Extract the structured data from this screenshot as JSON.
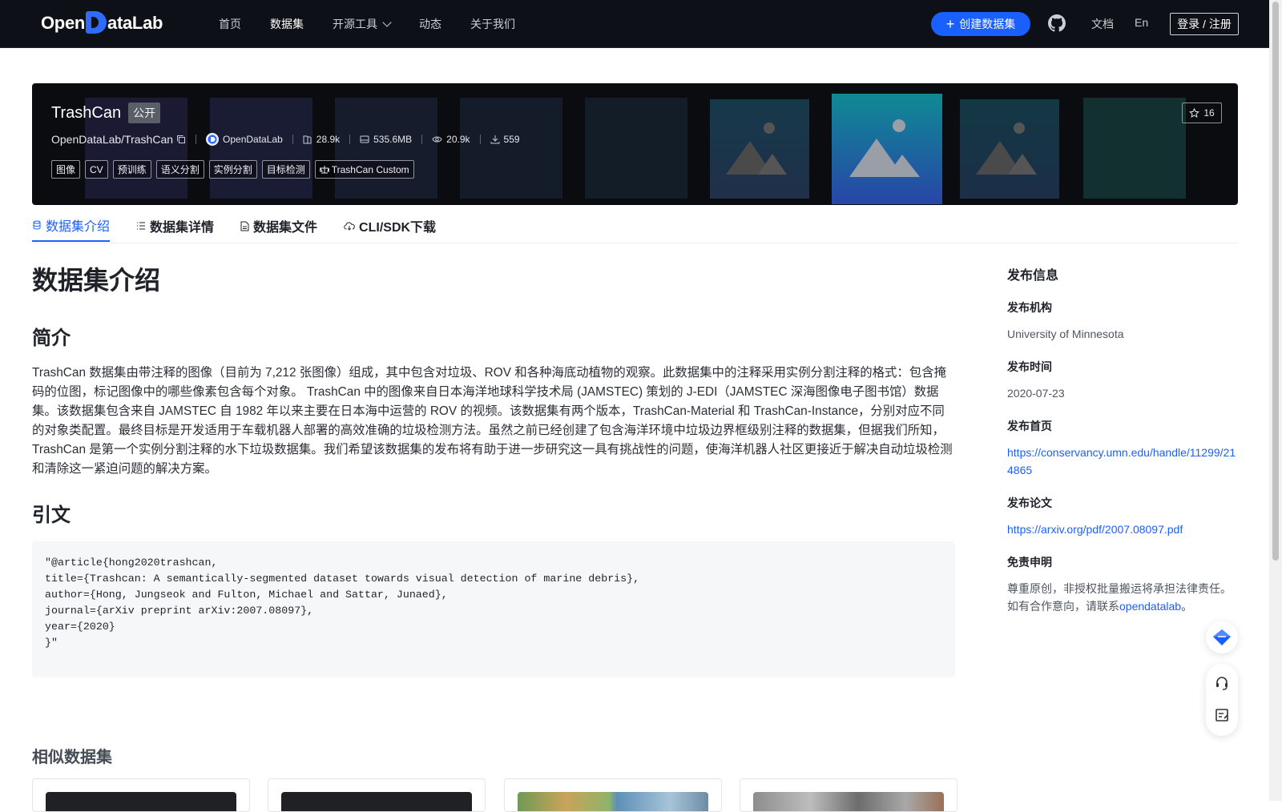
{
  "nav": {
    "logo_text_left": "Open",
    "logo_text_right": "ataLab",
    "items": [
      {
        "label": "首页",
        "active": false
      },
      {
        "label": "数据集",
        "active": true
      },
      {
        "label": "开源工具",
        "active": false,
        "has_dropdown": true
      },
      {
        "label": "动态",
        "active": false
      },
      {
        "label": "关于我们",
        "active": false
      }
    ],
    "create_label": "创建数据集",
    "docs_label": "文档",
    "lang_label": "En",
    "login_label": "登录 / 注册"
  },
  "dataset": {
    "title": "TrashCan",
    "visibility": "公开",
    "path": "OpenDataLab/TrashCan",
    "publisher": "OpenDataLab",
    "file_count": "28.9k",
    "size": "535.6MB",
    "views": "20.9k",
    "downloads": "559",
    "stars": "16",
    "tags": [
      "图像",
      "CV",
      "预训练",
      "语义分割",
      "实例分割",
      "目标检测"
    ],
    "license": "TrashCan Custom"
  },
  "tabs": [
    {
      "label": "数据集介绍",
      "active": true
    },
    {
      "label": "数据集详情",
      "active": false
    },
    {
      "label": "数据集文件",
      "active": false
    },
    {
      "label": "CLI/SDK下载",
      "active": false
    }
  ],
  "content": {
    "heading": "数据集介绍",
    "intro_heading": "简介",
    "intro_text": "TrashCan 数据集由带注释的图像（目前为 7,212 张图像）组成，其中包含对垃圾、ROV 和各种海底动植物的观察。此数据集中的注释采用实例分割注释的格式：包含掩码的位图，标记图像中的哪些像素包含每个对象。 TrashCan 中的图像来自日本海洋地球科学技术局 (JAMSTEC) 策划的 J-EDI（JAMSTEC 深海图像电子图书馆）数据集。该数据集包含来自 JAMSTEC 自 1982 年以来主要在日本海中运营的 ROV 的视频。该数据集有两个版本，TrashCan-Material 和 TrashCan-Instance，分别对应不同的对象类配置。最终目标是开发适用于车载机器人部署的高效准确的垃圾检测方法。虽然之前已经创建了包含海洋环境中垃圾边界框级别注释的数据集，但据我们所知，TrashCan 是第一个实例分割注释的水下垃圾数据集。我们希望该数据集的发布将有助于进一步研究这一具有挑战性的问题，使海洋机器人社区更接近于解决自动垃圾检测和清除这一紧迫问题的解决方案。",
    "citation_heading": "引文",
    "citation_code": "\"@article{hong2020trashcan,\ntitle={Trashcan: A semantically-segmented dataset towards visual detection of marine debris},\nauthor={Hong, Jungseok and Fulton, Michael and Sattar, Junaed},\njournal={arXiv preprint arXiv:2007.08097},\nyear={2020}\n}\"",
    "similar_heading": "相似数据集"
  },
  "sidebar": {
    "title": "发布信息",
    "org_label": "发布机构",
    "org_value": "University of Minnesota",
    "date_label": "发布时间",
    "date_value": "2020-07-23",
    "homepage_label": "发布首页",
    "homepage_value": "https://conservancy.umn.edu/handle/11299/214865",
    "paper_label": "发布论文",
    "paper_value": "https://arxiv.org/pdf/2007.08097.pdf",
    "disclaimer_label": "免责申明",
    "disclaimer_line1": "尊重原创，非授权批量搬运将承担法律责任。",
    "disclaimer_line2_prefix": "如有合作意向，请联系",
    "disclaimer_link": "opendatalab",
    "disclaimer_line2_suffix": "。"
  },
  "colors": {
    "nav_bg": "#0d1117",
    "accent": "#1a5fff",
    "banner_bg": "#0a0c10"
  },
  "icons": [
    "github-icon",
    "copy-icon",
    "org-avatar-icon",
    "file-count-icon",
    "disk-icon",
    "eye-icon",
    "download-icon",
    "star-icon",
    "license-icon",
    "database-icon",
    "list-icon",
    "file-icon",
    "cloud-icon",
    "ai-assistant-icon",
    "headset-icon",
    "feedback-icon"
  ]
}
